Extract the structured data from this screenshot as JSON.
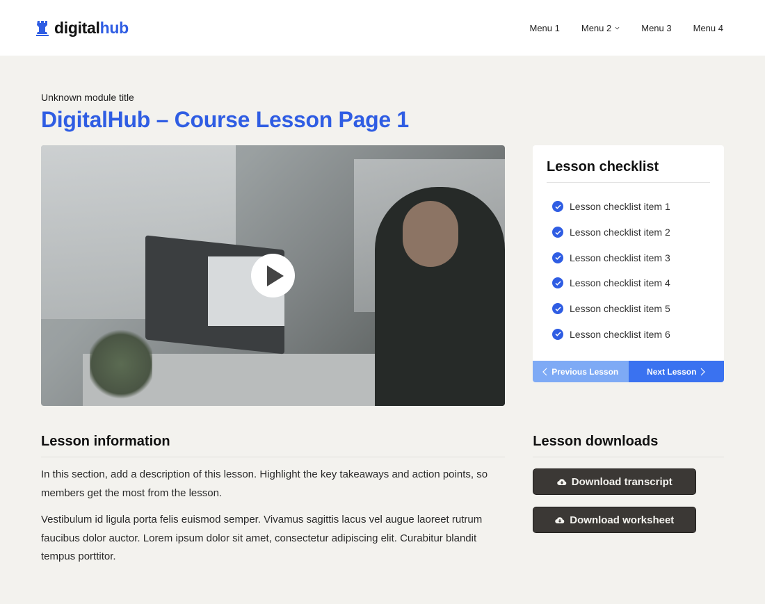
{
  "header": {
    "logo_primary": "digital",
    "logo_accent": "hub",
    "logo_icon": "tower-icon",
    "nav": [
      {
        "label": "Menu 1",
        "has_dropdown": false
      },
      {
        "label": "Menu 2",
        "has_dropdown": true
      },
      {
        "label": "Menu 3",
        "has_dropdown": false
      },
      {
        "label": "Menu 4",
        "has_dropdown": false
      }
    ]
  },
  "page": {
    "module_title": "Unknown module title",
    "title": "DigitalHub – Course Lesson Page 1"
  },
  "video": {
    "play_icon": "play-icon"
  },
  "checklist": {
    "title": "Lesson checklist",
    "items": [
      "Lesson checklist item 1",
      "Lesson checklist item 2",
      "Lesson checklist item 3",
      "Lesson checklist item 4",
      "Lesson checklist item 5",
      "Lesson checklist item 6"
    ],
    "prev_label": "Previous Lesson",
    "next_label": "Next Lesson"
  },
  "info": {
    "title": "Lesson information",
    "paragraphs": [
      "In this section, add a description of this lesson. Highlight the key takeaways and action points, so members get the most from the lesson.",
      "Vestibulum id ligula porta felis euismod semper. Vivamus sagittis lacus vel augue laoreet rutrum faucibus dolor auctor. Lorem ipsum dolor sit amet, consectetur adipiscing elit. Curabitur blandit tempus porttitor."
    ]
  },
  "downloads": {
    "title": "Lesson downloads",
    "buttons": [
      "Download transcript",
      "Download worksheet"
    ]
  },
  "colors": {
    "brand": "#2f5de3",
    "next_button": "#3a72f0",
    "prev_button": "#7eaaf5",
    "download_button": "#3b3835",
    "background": "#f3f2ee"
  }
}
